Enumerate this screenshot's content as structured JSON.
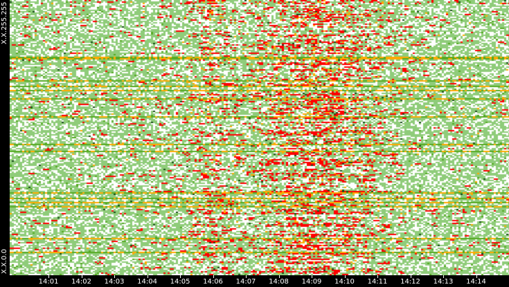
{
  "chart_data": {
    "type": "heatmap",
    "title": "",
    "xlabel": "",
    "ylabel": "",
    "y_tick_labels": [
      "X.X.255.255",
      "X.X.0.0"
    ],
    "x_tick_labels": [
      "14:01",
      "14:02",
      "14:03",
      "14:04",
      "14:05",
      "14:06",
      "14:07",
      "14:08",
      "14:09",
      "14:10",
      "14:11",
      "14:12",
      "14:13",
      "14:14"
    ],
    "x_tick_minutes": [
      1,
      2,
      3,
      4,
      5,
      6,
      7,
      8,
      9,
      10,
      11,
      12,
      13,
      14
    ],
    "xlim_minutes": [
      -0.18,
      15.0
    ],
    "colors": {
      "empty": "#ffffff",
      "low": "#8fcc7a",
      "medium": "#55aa22",
      "high": "#ffaa00",
      "peak": "#ff0000",
      "dark": "#1a4d1a"
    },
    "intensity_by_minute": [
      0.1,
      0.1,
      0.1,
      0.1,
      0.15,
      0.2,
      0.6,
      0.3,
      0.8,
      1.0,
      0.85,
      0.4,
      0.15,
      0.1,
      0.1,
      0.1
    ]
  }
}
